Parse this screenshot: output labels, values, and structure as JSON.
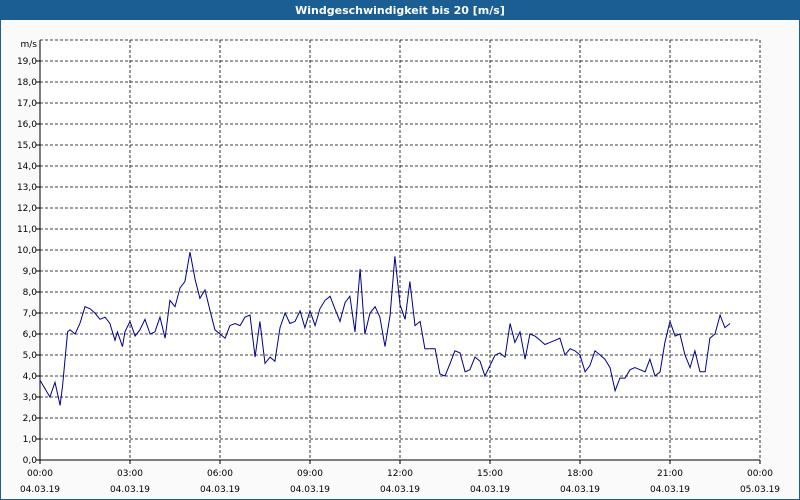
{
  "window": {
    "title": "Windgeschwindigkeit bis 20 [m/s]"
  },
  "chart_data": {
    "type": "line",
    "title": "Windgeschwindigkeit bis 20 [m/s]",
    "ylabel": "m/s",
    "xlabel": "",
    "ylim": [
      0,
      20
    ],
    "xlim_hours": [
      0,
      24
    ],
    "grid": true,
    "y_ticks": [
      "0,0",
      "1,0",
      "2,0",
      "3,0",
      "4,0",
      "5,0",
      "6,0",
      "7,0",
      "8,0",
      "9,0",
      "10,0",
      "11,0",
      "12,0",
      "13,0",
      "14,0",
      "15,0",
      "16,0",
      "17,0",
      "18,0",
      "19,0"
    ],
    "x_ticks": [
      {
        "time": "00:00",
        "date": "04.03.19"
      },
      {
        "time": "03:00",
        "date": "04.03.19"
      },
      {
        "time": "06:00",
        "date": "04.03.19"
      },
      {
        "time": "09:00",
        "date": "04.03.19"
      },
      {
        "time": "12:00",
        "date": "04.03.19"
      },
      {
        "time": "15:00",
        "date": "04.03.19"
      },
      {
        "time": "18:00",
        "date": "04.03.19"
      },
      {
        "time": "21:00",
        "date": "04.03.19"
      },
      {
        "time": "00:00",
        "date": "05.03.19"
      }
    ],
    "series": [
      {
        "color": "#00008b",
        "x_hours": [
          0.0,
          0.33,
          0.5,
          0.67,
          0.75,
          0.92,
          1.0,
          1.17,
          1.33,
          1.5,
          1.67,
          1.83,
          2.0,
          2.17,
          2.33,
          2.5,
          2.58,
          2.75,
          2.83,
          3.0,
          3.17,
          3.33,
          3.5,
          3.67,
          3.83,
          4.0,
          4.17,
          4.33,
          4.5,
          4.67,
          4.83,
          5.0,
          5.17,
          5.33,
          5.5,
          5.67,
          5.83,
          6.0,
          6.17,
          6.33,
          6.5,
          6.67,
          6.83,
          7.0,
          7.17,
          7.33,
          7.5,
          7.67,
          7.83,
          8.0,
          8.17,
          8.33,
          8.5,
          8.67,
          8.83,
          9.0,
          9.17,
          9.33,
          9.5,
          9.67,
          9.83,
          10.0,
          10.17,
          10.33,
          10.5,
          10.67,
          10.83,
          11.0,
          11.17,
          11.33,
          11.5,
          11.67,
          11.83,
          12.0,
          12.17,
          12.33,
          12.5,
          12.67,
          12.83,
          13.0,
          13.17,
          13.33,
          13.5,
          13.67,
          13.83,
          14.0,
          14.17,
          14.33,
          14.5,
          14.67,
          14.83,
          15.0,
          15.17,
          15.33,
          15.5,
          15.67,
          15.83,
          16.0,
          16.17,
          16.33,
          16.5,
          16.67,
          16.83,
          17.0,
          17.17,
          17.33,
          17.5,
          17.67,
          17.83,
          18.0,
          18.17,
          18.33,
          18.5,
          18.67,
          18.83,
          19.0,
          19.17,
          19.33,
          19.5,
          19.67,
          19.83,
          20.0,
          20.17,
          20.33,
          20.5,
          20.67,
          20.83,
          21.0,
          21.17,
          21.33,
          21.5,
          21.67,
          21.83,
          22.0,
          22.17,
          22.33,
          22.5,
          22.67,
          22.83,
          23.0,
          23.17,
          23.33,
          23.5,
          23.67,
          23.83,
          24.0
        ],
        "values": [
          3.8,
          3.0,
          3.7,
          2.6,
          3.5,
          6.1,
          6.2,
          6.0,
          6.5,
          7.3,
          7.2,
          7.0,
          6.7,
          6.8,
          6.5,
          5.7,
          6.1,
          5.4,
          6.1,
          6.6,
          5.9,
          6.2,
          6.7,
          6.0,
          6.1,
          6.8,
          5.8,
          7.6,
          7.3,
          8.2,
          8.5,
          9.9,
          8.6,
          7.7,
          8.1,
          7.1,
          6.2,
          6.0,
          5.8,
          6.4,
          6.5,
          6.4,
          6.8,
          6.9,
          4.9,
          6.6,
          4.6,
          4.9,
          4.7,
          6.3,
          7.0,
          6.5,
          6.6,
          7.1,
          6.3,
          7.1,
          6.4,
          7.2,
          7.6,
          7.8,
          7.2,
          6.6,
          7.5,
          7.8,
          6.1,
          9.1,
          6.0,
          7.0,
          7.3,
          6.8,
          5.4,
          6.9,
          9.7,
          7.4,
          6.7,
          8.5,
          6.4,
          6.6,
          5.3,
          5.3,
          5.3,
          4.1,
          4.0,
          4.6,
          5.2,
          5.1,
          4.2,
          4.3,
          4.9,
          4.7,
          4.0,
          4.5,
          5.0,
          5.1,
          4.9,
          6.5,
          5.6,
          6.1,
          4.8,
          6.0,
          5.9,
          5.7,
          5.5,
          5.6,
          5.7,
          5.8,
          5.0,
          5.3,
          5.2,
          5.0,
          4.2,
          4.5,
          5.2,
          5.0,
          4.8,
          4.4,
          3.3,
          3.9,
          3.9,
          4.3,
          4.4,
          4.3,
          4.2,
          4.8,
          4.0,
          4.2,
          5.6,
          6.6,
          5.9,
          6.0,
          5.0,
          4.4,
          5.2,
          4.2,
          4.2,
          5.8,
          6.0,
          6.9,
          6.3,
          6.5
        ]
      }
    ]
  }
}
